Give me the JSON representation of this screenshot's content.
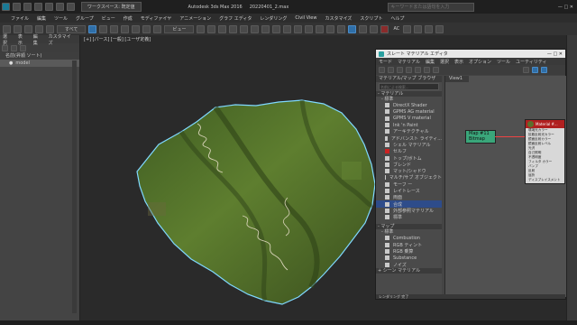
{
  "titlebar": {
    "workspace": "ワークスペース: 既定値",
    "app_title": "Autodesk 3ds Max 2016",
    "file_name": "20220401_2.max",
    "search_placeholder": "キーワードまたは語句を入力"
  },
  "menubar": [
    "ファイル",
    "編集",
    "ツール",
    "グループ",
    "ビュー",
    "作成",
    "モディファイヤ",
    "アニメーション",
    "グラフ エディタ",
    "レンダリング",
    "Civil View",
    "カスタマイズ",
    "スクリプト",
    "ヘルプ"
  ],
  "toolbar": {
    "filter_select": "すべて",
    "view_select": "ビュー",
    "ac_label": "AC"
  },
  "left_panel": {
    "tabs": [
      "選択",
      "表示",
      "編集",
      "カスタマイズ"
    ],
    "tree_root": "名前(昇順 ソート)",
    "tree_item": "model"
  },
  "viewport": {
    "label": "[+] [パース] [一般] [ユーザ定義]"
  },
  "slate": {
    "title": "スレート マテリアル エディタ",
    "menus": [
      "モード",
      "マテリアル",
      "編集",
      "選択",
      "表示",
      "オプション",
      "ツール",
      "ユーティリティ"
    ],
    "browser_header": "マテリアル/マップ ブラウザ",
    "search_placeholder": "名前による検索...",
    "section_materials": "- マテリアル",
    "section_standard": "- 標準",
    "materials": [
      "DirectX Shader",
      "GPMS AG material",
      "GPMS V material",
      "Ink 'n Paint",
      "アーキテクチャル",
      "アドバンスト ライティ...",
      "シェル マテリアル",
      "セルフ",
      "トップ/ボトム",
      "ブレンド",
      "マット/シャドウ",
      "マルチ/サブ オブジェクト",
      "モーフ ー",
      "レイトレース",
      "両面",
      "合成",
      "外部参照マテリアル",
      "標準"
    ],
    "highlight_index": 15,
    "section_maps": "- マップ",
    "maps_standard": "- 標準",
    "maps": [
      "Combustion",
      "RGB ティント",
      "RGB 乗算",
      "Substance",
      "ノイズ"
    ],
    "maps_footer": "+ シーン マテリアル",
    "view_label": "View1",
    "node_map_label": "Map #11",
    "node_map_type": "Bitmap",
    "node_mat_title": "Material #...",
    "node_mat_slots": [
      "環境光カラー",
      "拡散反射光カラー",
      "鏡面反射カラー",
      "鏡面反射レベル",
      "光沢",
      "自己照明",
      "不透明度",
      "フィルタ カラー",
      "バンプ",
      "反射",
      "屈折",
      "ディスプレイスメント"
    ],
    "status": "レンダリング 完了"
  },
  "colors": {
    "terrain_edge": "#7fd8ff",
    "highlight": "#2e4c8a",
    "node_map": "#3aa67a",
    "node_mat": "#b02020"
  }
}
